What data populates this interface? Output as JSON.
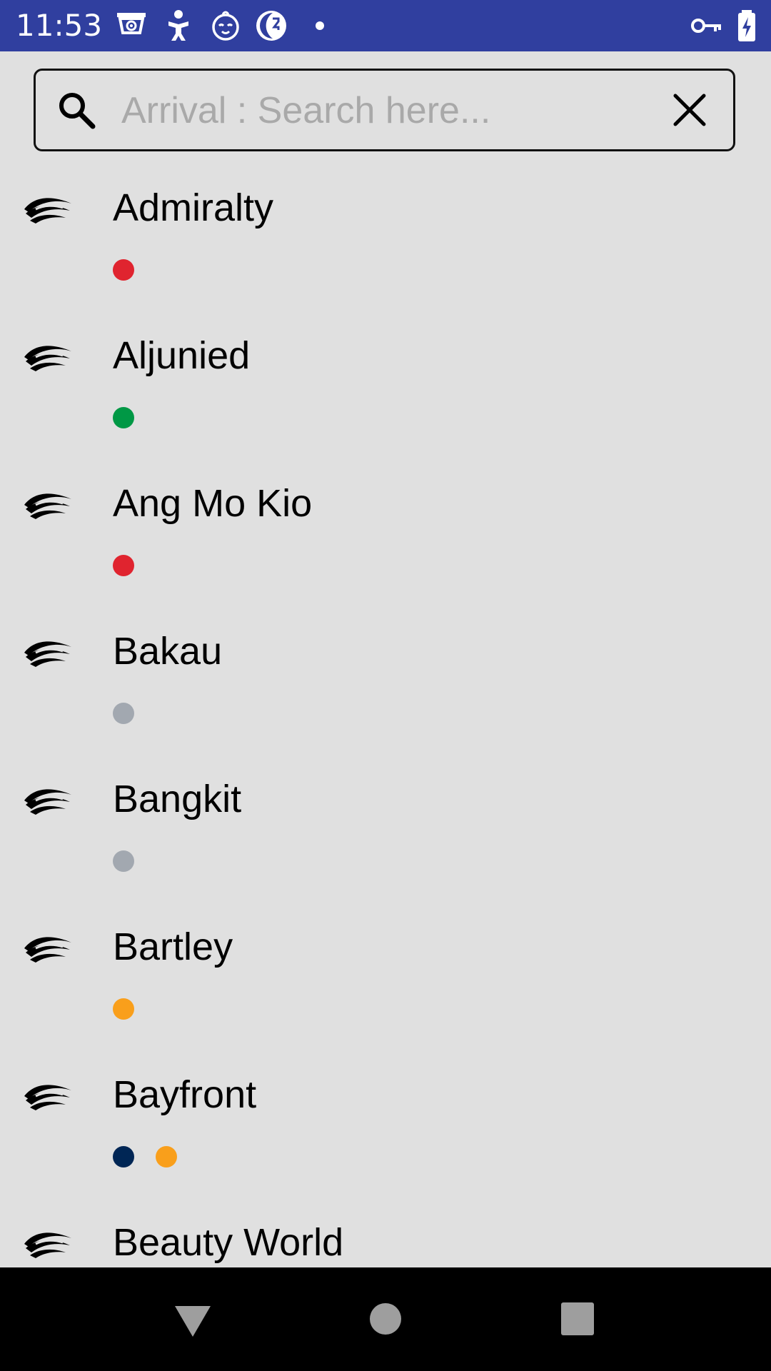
{
  "status_bar": {
    "time": "11:53",
    "icons": [
      "cctv-icon",
      "baby-icon",
      "face-icon",
      "moon-icon",
      "dot-icon",
      "vpn-key-icon",
      "battery-charging-icon"
    ],
    "background": "#303f9f"
  },
  "search": {
    "placeholder": "Arrival : Search here...",
    "value": ""
  },
  "stations": [
    {
      "name": "Admiralty",
      "lines": [
        "#e0242f"
      ]
    },
    {
      "name": "Aljunied",
      "lines": [
        "#009845"
      ]
    },
    {
      "name": "Ang Mo Kio",
      "lines": [
        "#e0242f"
      ]
    },
    {
      "name": "Bakau",
      "lines": [
        "#a2a8b0"
      ]
    },
    {
      "name": "Bangkit",
      "lines": [
        "#a2a8b0"
      ]
    },
    {
      "name": "Bartley",
      "lines": [
        "#f99f1b"
      ]
    },
    {
      "name": "Bayfront",
      "lines": [
        "#002655",
        "#f99f1b"
      ]
    },
    {
      "name": "Beauty World",
      "lines": []
    }
  ],
  "navigation": {
    "buttons": [
      "back-icon",
      "home-icon",
      "recents-icon"
    ]
  }
}
